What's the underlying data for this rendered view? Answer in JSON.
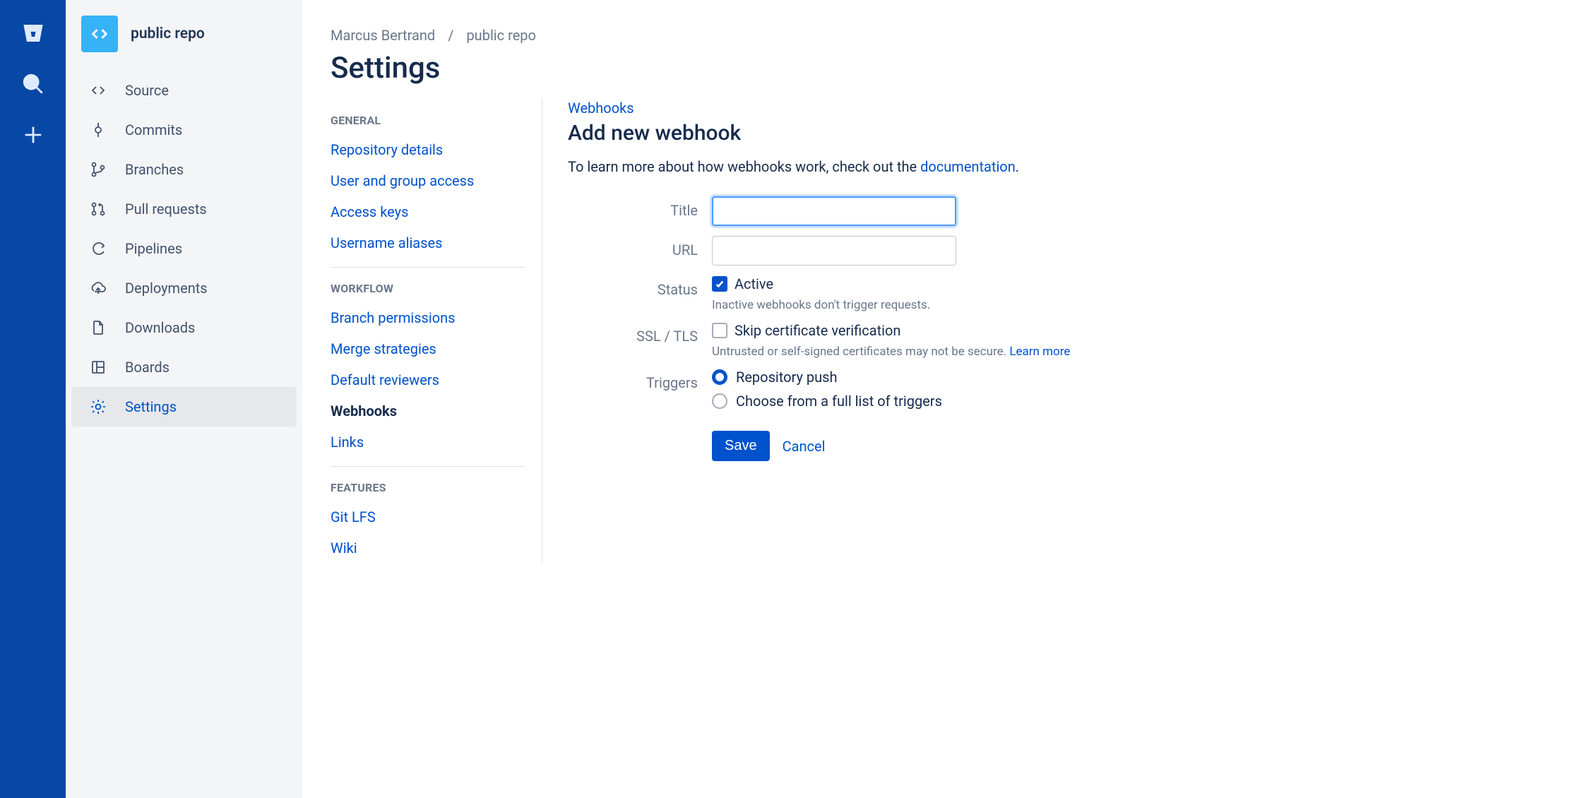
{
  "rail": {
    "items": [
      "bitbucket-logo",
      "search-icon",
      "plus-icon"
    ]
  },
  "repo": {
    "title": "public repo",
    "nav": [
      {
        "label": "Source",
        "icon": "code-icon"
      },
      {
        "label": "Commits",
        "icon": "commit-icon"
      },
      {
        "label": "Branches",
        "icon": "branch-icon"
      },
      {
        "label": "Pull requests",
        "icon": "pull-request-icon"
      },
      {
        "label": "Pipelines",
        "icon": "pipeline-icon"
      },
      {
        "label": "Deployments",
        "icon": "deploy-icon"
      },
      {
        "label": "Downloads",
        "icon": "download-icon"
      },
      {
        "label": "Boards",
        "icon": "board-icon"
      },
      {
        "label": "Settings",
        "icon": "gear-icon",
        "active": true
      }
    ]
  },
  "breadcrumb": {
    "owner": "Marcus Bertrand",
    "sep": "/",
    "repo": "public repo"
  },
  "page_title": "Settings",
  "settings_nav": {
    "general_header": "GENERAL",
    "general": [
      "Repository details",
      "User and group access",
      "Access keys",
      "Username aliases"
    ],
    "workflow_header": "WORKFLOW",
    "workflow": [
      "Branch permissions",
      "Merge strategies",
      "Default reviewers",
      "Webhooks",
      "Links"
    ],
    "features_header": "FEATURES",
    "features": [
      "Git LFS",
      "Wiki"
    ]
  },
  "content": {
    "parent_link": "Webhooks",
    "heading": "Add new webhook",
    "intro_prefix": "To learn more about how webhooks work, check out the ",
    "intro_link": "documentation",
    "intro_suffix": ".",
    "labels": {
      "title": "Title",
      "url": "URL",
      "status": "Status",
      "ssl": "SSL / TLS",
      "triggers": "Triggers"
    },
    "status": {
      "active_label": "Active",
      "help": "Inactive webhooks don't trigger requests."
    },
    "ssl": {
      "label": "Skip certificate verification",
      "help": "Untrusted or self-signed certificates may not be secure. ",
      "learn_more": "Learn more"
    },
    "triggers": {
      "push": "Repository push",
      "choose": "Choose from a full list of triggers"
    },
    "actions": {
      "save": "Save",
      "cancel": "Cancel"
    }
  }
}
